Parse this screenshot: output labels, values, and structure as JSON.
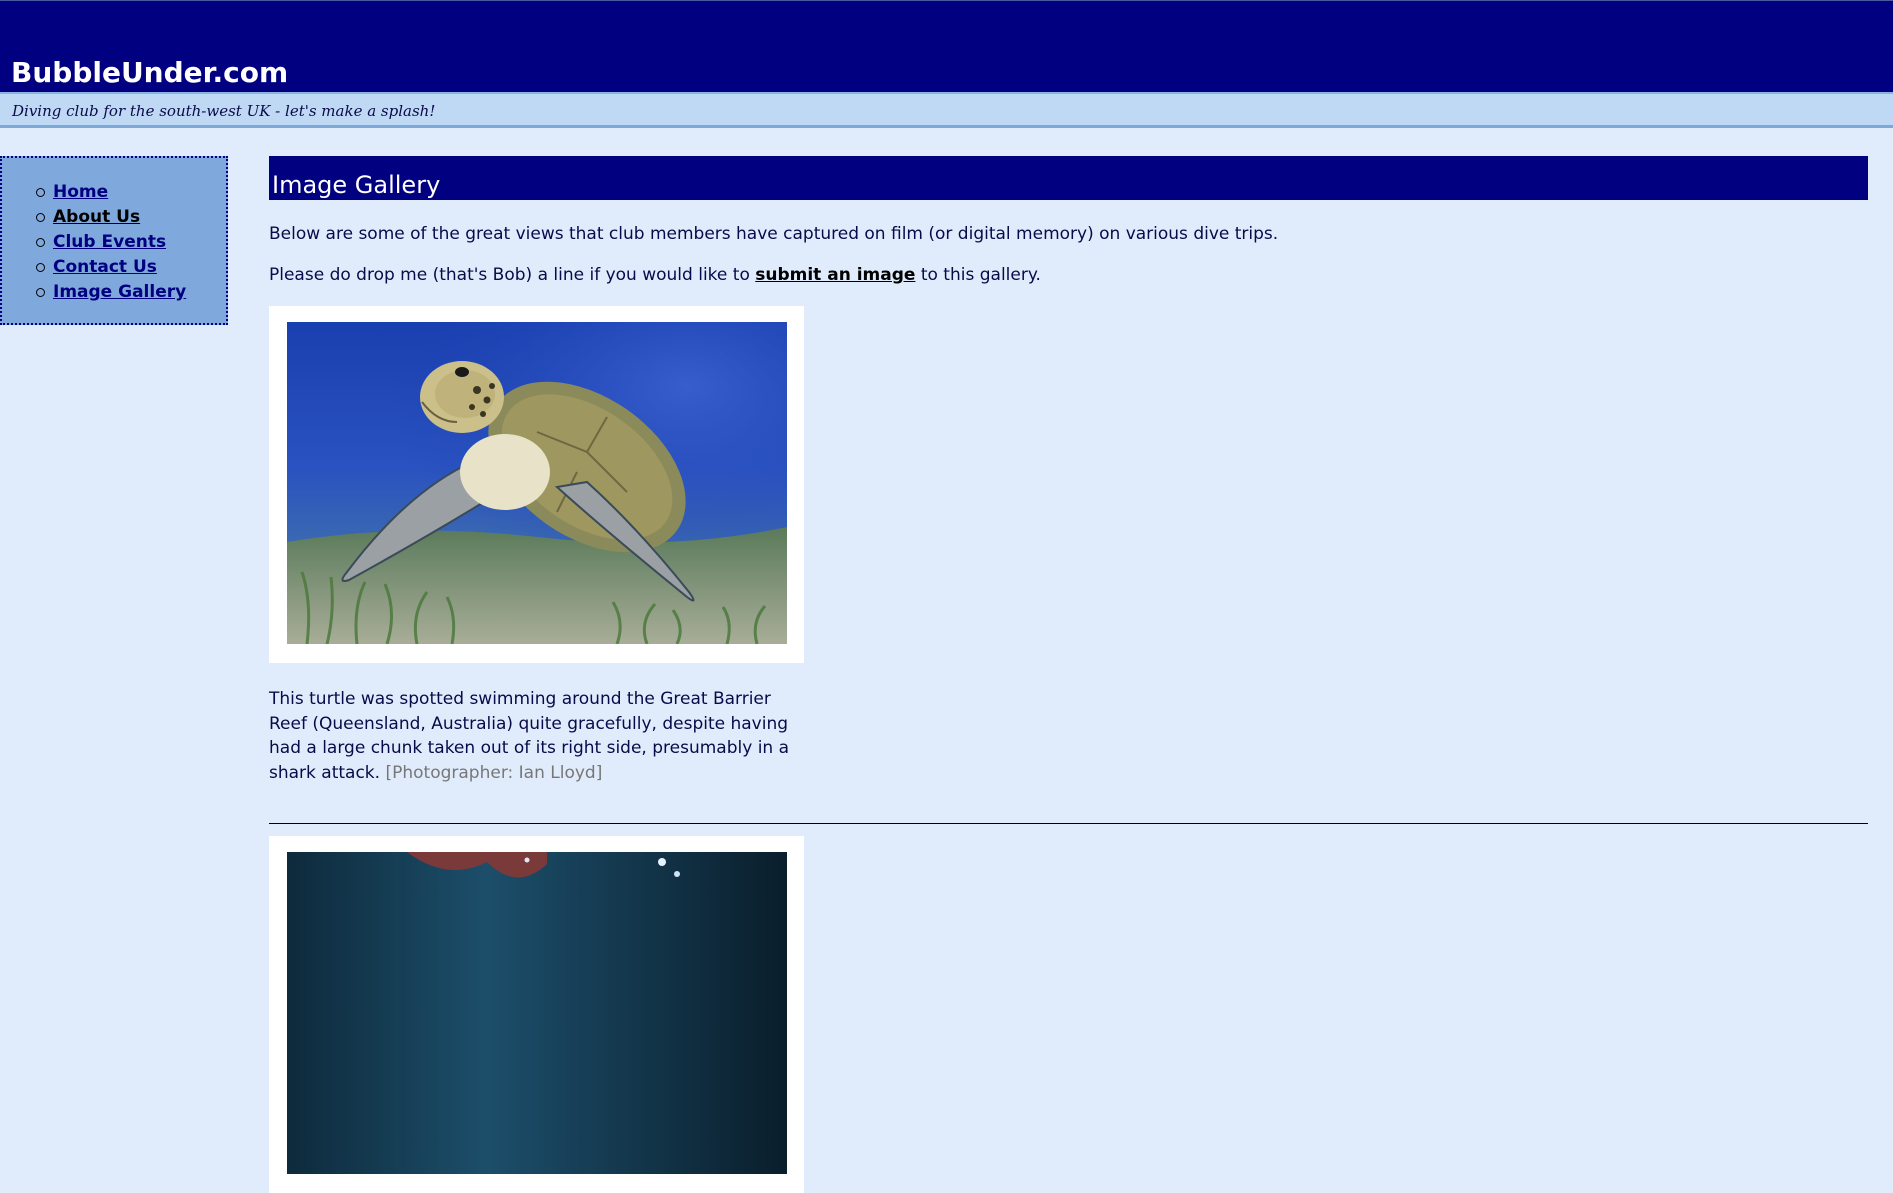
{
  "site": {
    "title": "BubbleUnder.com",
    "tagline": "Diving club for the south-west UK - let's make a splash!"
  },
  "nav": {
    "items": [
      {
        "label": "Home"
      },
      {
        "label": "About Us"
      },
      {
        "label": "Club Events"
      },
      {
        "label": "Contact Us"
      },
      {
        "label": "Image Gallery"
      }
    ]
  },
  "main": {
    "heading": "Image Gallery",
    "intro": "Below are some of the great views that club members have captured on film (or digital memory) on various dive trips.",
    "submit_before": "Please do drop me (that's Bob) a line if you would like to ",
    "submit_link": "submit an image",
    "submit_after": " to this gallery.",
    "gallery": [
      {
        "image": "sea-turtle-photo",
        "caption": "This turtle was spotted swimming around the Great Barrier Reef (Queensland, Australia) quite gracefully, despite having had a large chunk taken out of its right side, presumably in a shark attack.",
        "credit": "[Photographer: Ian Lloyd]"
      },
      {
        "image": "underwater-reef-photo"
      }
    ]
  },
  "colors": {
    "header_bg": "#000080",
    "tagline_bg": "#bfd9f4",
    "page_bg": "#e0ecfc",
    "nav_bg": "#7fa8dc"
  }
}
